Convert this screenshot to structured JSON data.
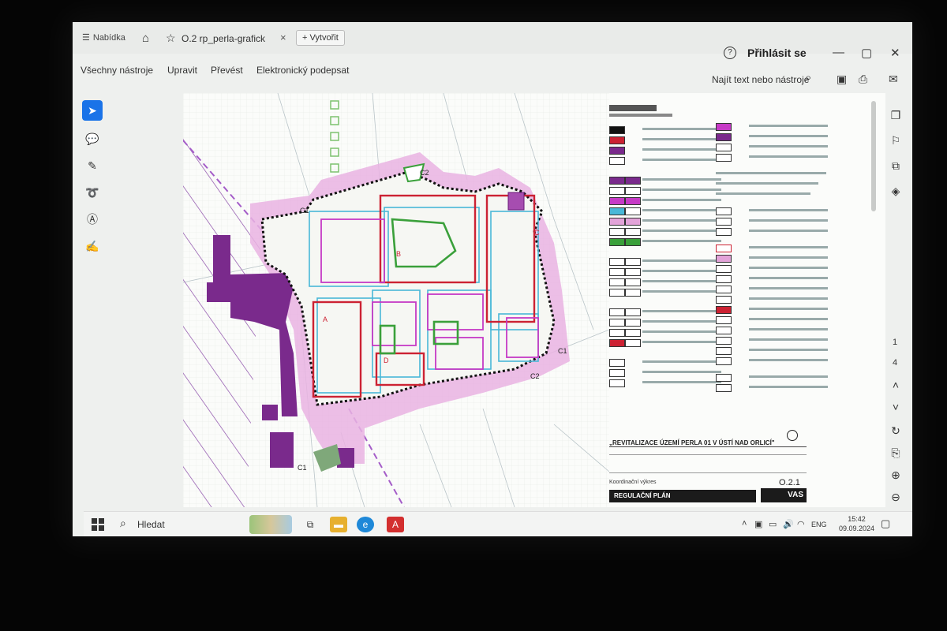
{
  "tabbar": {
    "home_label": "Nabídka",
    "tab_title": "O.2 rp_perla-grafick",
    "tab_close": "×",
    "new_tab_label": "+ Vytvořit",
    "help": "?",
    "sign_in": "Přihlásit se",
    "minimize": "—",
    "restore": "▢",
    "close": "✕"
  },
  "menubar": {
    "items": [
      "Všechny nástroje",
      "Upravit",
      "Převést",
      "Elektronický podepsat"
    ],
    "search_label": "Najít text nebo nástroje"
  },
  "drawing": {
    "labels": [
      "C1",
      "C1",
      "C1",
      "C2",
      "C2",
      "A",
      "B",
      "C",
      "D"
    ],
    "title": "„REVITALIZACE ÚZEMÍ PERLA 01 V ÚSTÍ NAD ORLICÍ\"",
    "drawing_code": "O.2.1",
    "drawing_subtitle": "Koordinační výkres",
    "plan_name": "REGULAČNÍ PLÁN",
    "logo": "VAS",
    "colors": {
      "purple": "#7a2a8c",
      "pink": "#e3a3d9",
      "red": "#cc2233",
      "green": "#3aa03a",
      "cyan": "#49b8d8",
      "magenta": "#c63ac6"
    }
  },
  "right_rail": {
    "page_current": "1",
    "page_total": "4"
  },
  "taskbar": {
    "search_label": "Hledat",
    "language": "ENG",
    "time": "15:42",
    "date": "09.09.2024"
  }
}
